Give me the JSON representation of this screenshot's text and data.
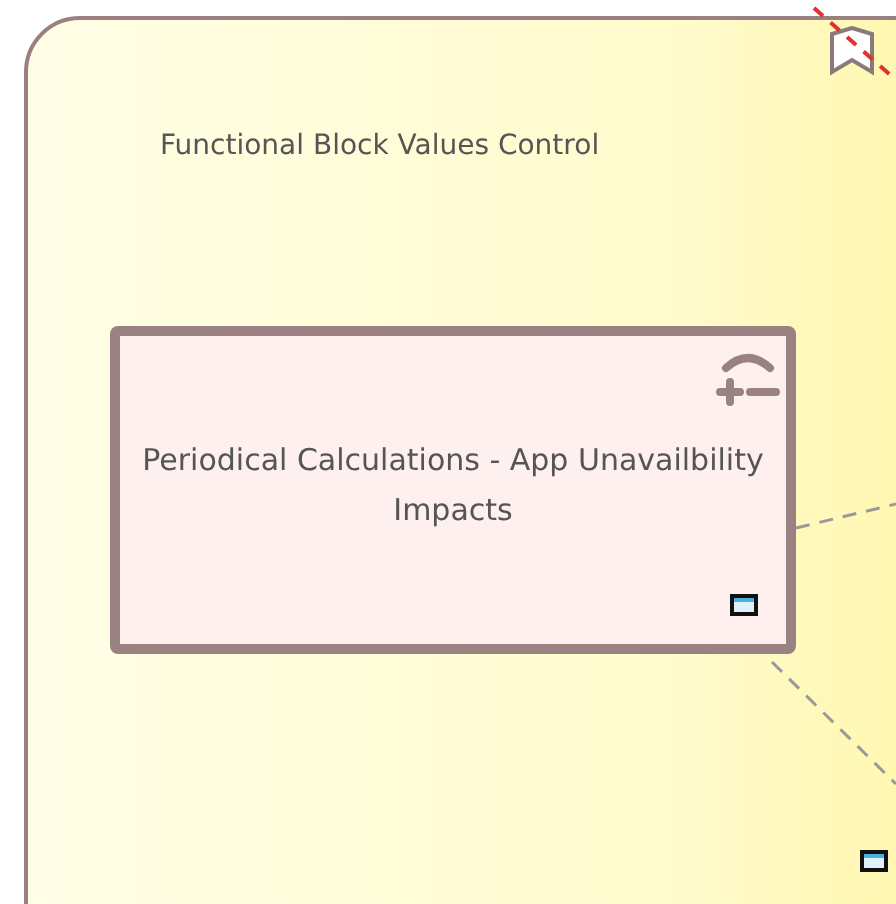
{
  "container": {
    "title": "Functional Block Values Control"
  },
  "block": {
    "title": "Periodical Calculations - App Unavailbility Impacts"
  }
}
